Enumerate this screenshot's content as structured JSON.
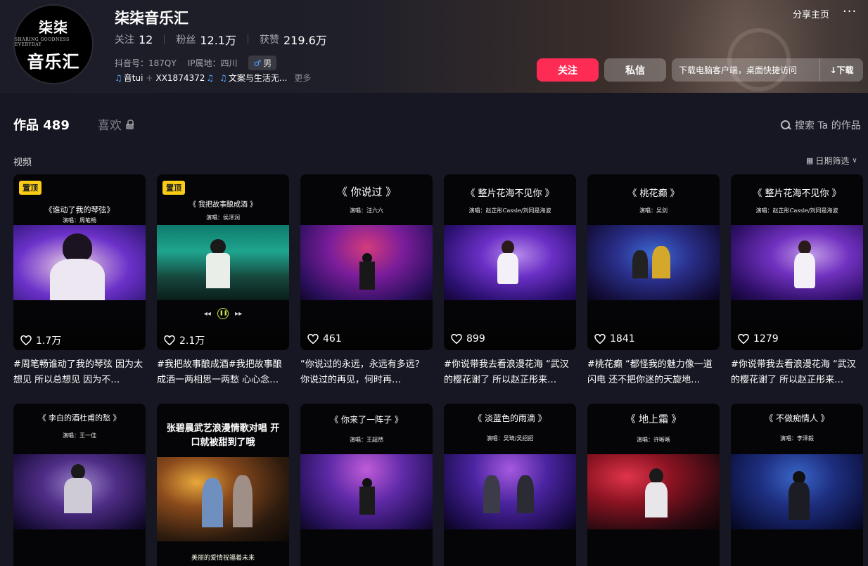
{
  "profile": {
    "name": "柒柒音乐汇",
    "avatar_line1": "柒柒",
    "avatar_line2": "SHARING GOODNESS EVERYDAY",
    "avatar_line3": "音乐汇",
    "follow_label": "关注",
    "follow_count": "12",
    "fans_label": "粉丝",
    "fans_count": "12.1万",
    "likes_label": "获赞",
    "likes_count": "219.6万",
    "douyin_id": "抖音号：187QY",
    "ip_location": "IP属地：四川",
    "gender": "男",
    "link1": "音tui",
    "link2": "XX1874372",
    "link3": "文案与生活无...",
    "more": "更多"
  },
  "header_actions": {
    "share": "分享主页",
    "more_icon": "···",
    "follow_button": "关注",
    "message_button": "私信",
    "download_tip": "下载电脑客户端，桌面快捷访问",
    "download_button": "↓下载"
  },
  "tabs": {
    "works": "作品 489",
    "likes": "喜欢"
  },
  "search": {
    "label": "搜索 Ta 的作品"
  },
  "section": {
    "label": "视频",
    "date_filter": "日期筛选"
  },
  "videos": [
    {
      "pinned": "置顶",
      "song": "《谁动了我的琴弦》",
      "singer": "演唱：周笔畅",
      "likes": "1.7万",
      "desc": "#周笔畅谁动了我的琴弦 因为太想见 所以总想见 因为不…"
    },
    {
      "pinned": "置顶",
      "song": "《 我把故事酿成酒 》",
      "singer": "演唱：侯泽润",
      "likes": "2.1万",
      "desc": "#我把故事酿成酒#我把故事酿成酒一两相思一两愁 心心念…"
    },
    {
      "song": "《 你说过 》",
      "singer": "演唱：汪六六",
      "likes": "461",
      "desc": "“你说过的永远，永远有多远？你说过的再见，何时再…"
    },
    {
      "song": "《 整片花海不见你 》",
      "singer": "演唱：赵芷彤Cassie/刘同是海波",
      "likes": "899",
      "desc": "#你说带我去看浪漫花海 “武汉的樱花谢了 所以赵芷彤来…"
    },
    {
      "song": "《 桃花癫 》",
      "singer": "演唱：吴剑",
      "likes": "1841",
      "desc": "#桃花癫 “都怪我的魅力像一道闪电 还不把你迷的天旋地…"
    },
    {
      "song": "《 整片花海不见你 》",
      "singer": "演唱：赵芷彤Cassie/刘同是海波",
      "likes": "1279",
      "desc": "#你说带我去看浪漫花海 “武汉的樱花谢了 所以赵芷彤来…"
    },
    {
      "song": "《 李白的酒杜甫的愁 》",
      "singer": "演唱：王一佳"
    },
    {
      "headline": "张碧晨武艺浪漫情歌对唱 开口就被甜到了哦",
      "caption": "美丽的爱情祝福着未来"
    },
    {
      "song": "《 你来了一阵子 》",
      "singer": "演唱：王超然"
    },
    {
      "song": "《 淡蓝色的雨滴 》",
      "singer": "演唱：吴琦/吴招招"
    },
    {
      "song": "《 地上霜 》",
      "singer": "演唱：许晰晰"
    },
    {
      "song": "《 不做痴情人 》",
      "singer": "演唱：李泽毅"
    }
  ],
  "colors": {
    "accent_red": "#fe2c55",
    "pin_yellow": "#facc15",
    "background": "#161722"
  }
}
